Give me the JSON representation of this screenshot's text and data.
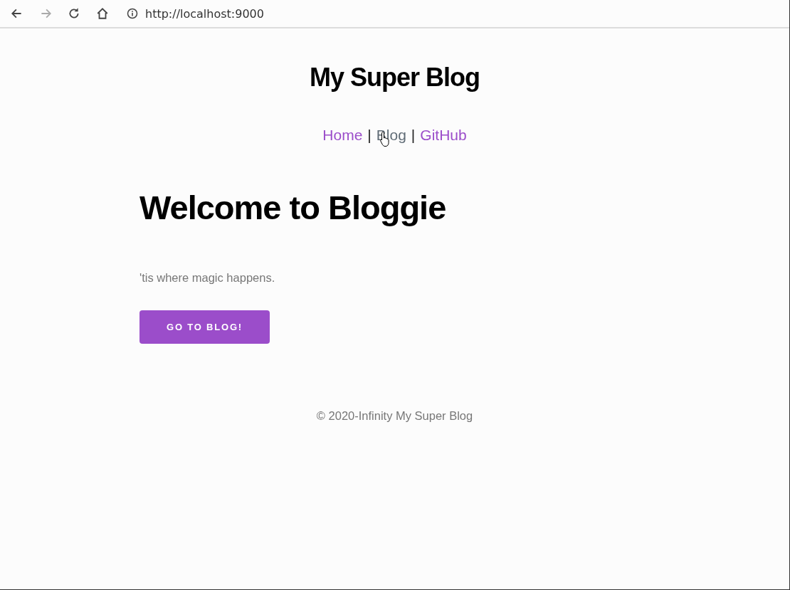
{
  "browser": {
    "buttons": [
      {
        "kind": "back",
        "disabled": false
      },
      {
        "kind": "forward",
        "disabled": true
      },
      {
        "kind": "reload",
        "disabled": false
      },
      {
        "kind": "home",
        "disabled": false
      }
    ],
    "url": "http://localhost:9000"
  },
  "site_title": "My Super Blog",
  "nav": [
    {
      "kind": "link",
      "label": "Home",
      "hovered": false
    },
    {
      "kind": "separator",
      "label": "|"
    },
    {
      "kind": "link",
      "label": "Blog",
      "hovered": true
    },
    {
      "kind": "separator",
      "label": "|"
    },
    {
      "kind": "link",
      "label": "GitHub",
      "hovered": false
    }
  ],
  "heading": "Welcome to Bloggie",
  "tagline": "'tis where magic happens.",
  "button": "GO TO BLOG!",
  "footer": "© 2020-Infinity My Super Blog"
}
